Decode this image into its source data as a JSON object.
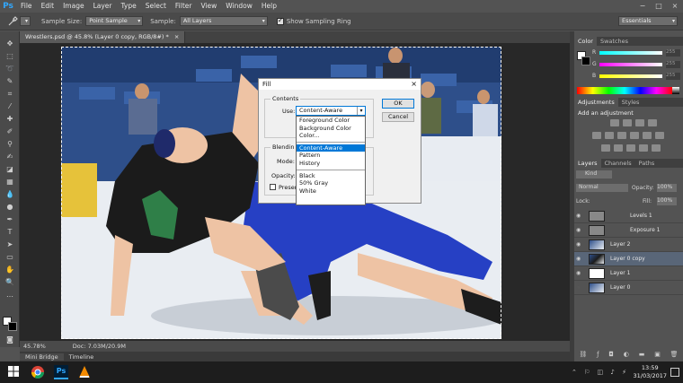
{
  "app": {
    "logo": "Ps"
  },
  "menu": [
    "File",
    "Edit",
    "Image",
    "Layer",
    "Type",
    "Select",
    "Filter",
    "View",
    "Window",
    "Help"
  ],
  "window_controls": [
    "−",
    "□",
    "×"
  ],
  "options_bar": {
    "sample_size_label": "Sample Size:",
    "sample_size_value": "Point Sample",
    "sample_label": "Sample:",
    "sample_value": "All Layers",
    "sampling_ring_label": "Show Sampling Ring",
    "workspace_value": "Essentials"
  },
  "document_tab": {
    "title": "Wrestlers.psd @ 45.8% (Layer 0 copy, RGB/8#) *",
    "close": "×"
  },
  "status": {
    "zoom": "45.78%",
    "doc": "Doc: 7.03M/20.9M"
  },
  "bottom_tabs": [
    "Mini Bridge",
    "Timeline"
  ],
  "fill_dialog": {
    "title": "Fill",
    "close": "×",
    "contents_legend": "Contents",
    "use_label": "Use:",
    "use_value": "Content-Aware",
    "ok_label": "OK",
    "cancel_label": "Cancel",
    "blending_legend": "Blendin",
    "mode_label": "Mode:",
    "opacity_label": "Opacity:",
    "preserve_label": "Preser",
    "dropdown_items_a": [
      "Foreground Color",
      "Background Color",
      "Color..."
    ],
    "dropdown_items_b": [
      "Content-Aware",
      "Pattern",
      "History"
    ],
    "dropdown_items_c": [
      "Black",
      "50% Gray",
      "White"
    ]
  },
  "color_panel": {
    "tabs": [
      "Color",
      "Swatches"
    ],
    "channels": [
      "R",
      "G",
      "B"
    ],
    "values": [
      "255",
      "255",
      "255"
    ]
  },
  "adjustments_panel": {
    "tabs": [
      "Adjustments",
      "Styles"
    ],
    "add_label": "Add an adjustment"
  },
  "layers_panel": {
    "tabs": [
      "Layers",
      "Channels",
      "Paths"
    ],
    "kind_label": "Kind",
    "blend_mode": "Normal",
    "opacity_label": "Opacity:",
    "opacity_value": "100%",
    "lock_label": "Lock:",
    "fill_label": "Fill:",
    "fill_value": "100%",
    "layers": [
      "Levels 1",
      "Exposure 1",
      "Layer 2",
      "Layer 0 copy",
      "Layer 1",
      "Layer 0"
    ],
    "selected_layer": "Layer 0 copy"
  },
  "taskbar": {
    "time": "13:59",
    "date": "31/03/2017"
  }
}
